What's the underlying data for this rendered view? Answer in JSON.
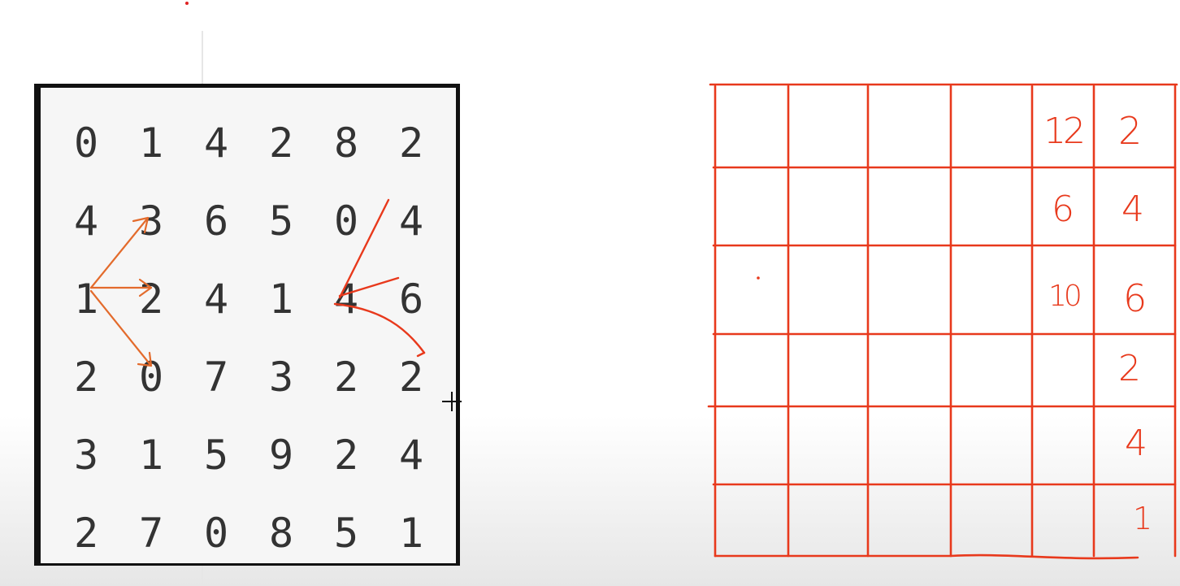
{
  "matrix": [
    [
      "0",
      "1",
      "4",
      "2",
      "8",
      "2"
    ],
    [
      "4",
      "3",
      "6",
      "5",
      "0",
      "4"
    ],
    [
      "1",
      "2",
      "4",
      "1",
      "4",
      "6"
    ],
    [
      "2",
      "0",
      "7",
      "3",
      "2",
      "2"
    ],
    [
      "3",
      "1",
      "5",
      "9",
      "2",
      "4"
    ],
    [
      "2",
      "7",
      "0",
      "8",
      "5",
      "1"
    ]
  ],
  "answer_grid": {
    "col5": [
      "12",
      "6",
      "10"
    ],
    "col6": [
      "2",
      "4",
      "6",
      "2",
      "4",
      "1"
    ]
  },
  "colors": {
    "ink_red": "#e8391c",
    "arrow_orange": "#e36b2c",
    "board_border": "#111111",
    "number_ink": "#333333"
  }
}
